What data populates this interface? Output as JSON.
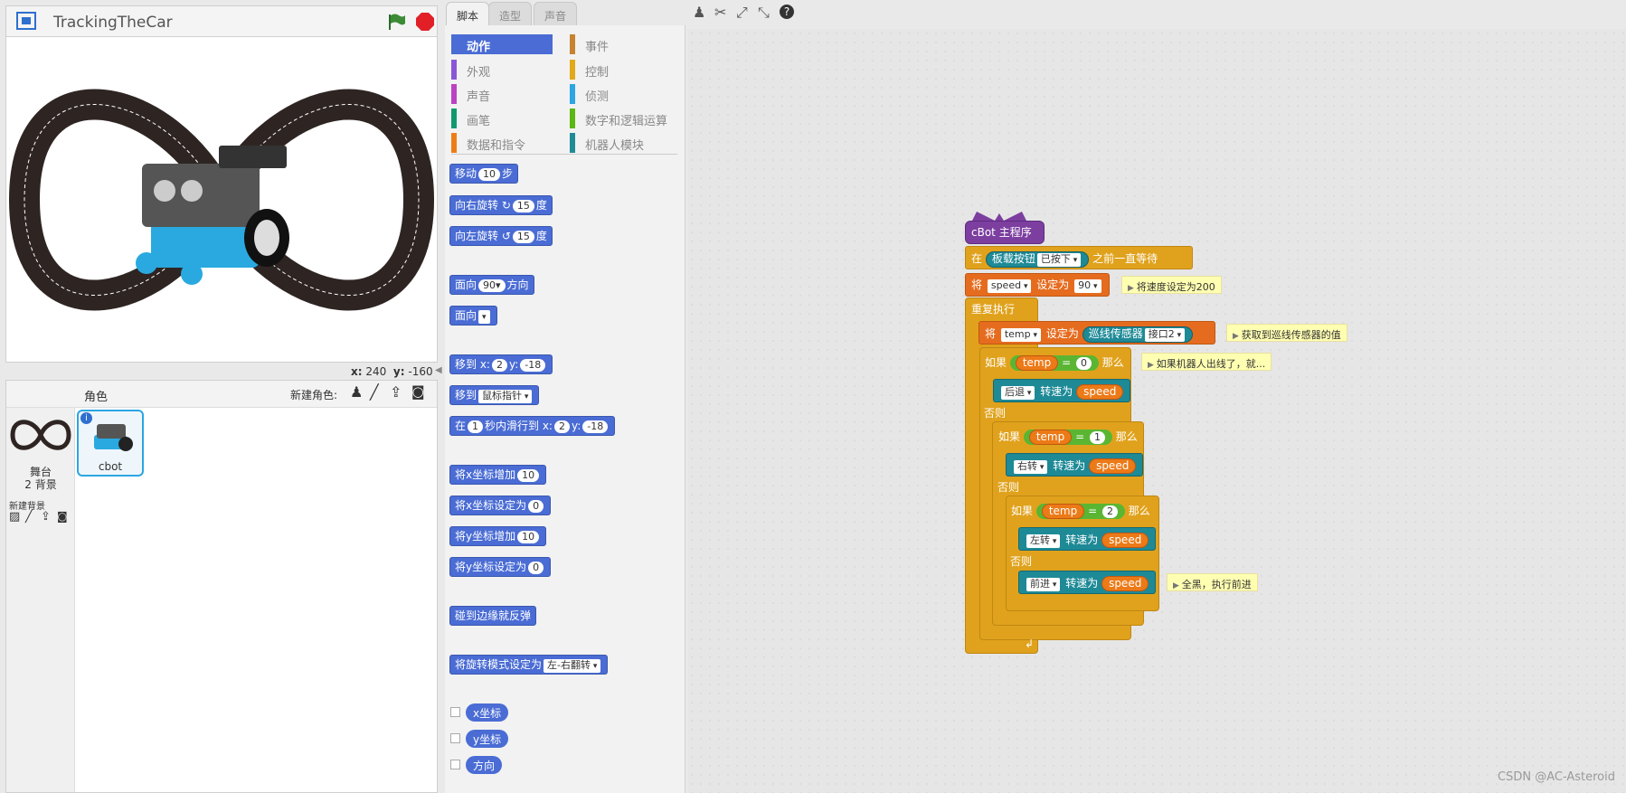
{
  "stage": {
    "title": "TrackingTheCar",
    "x_label": "x:",
    "x_value": "240",
    "y_label": "y:",
    "y_value": "-160"
  },
  "sprites": {
    "header": "角色",
    "new_sprite_label": "新建角色:",
    "stage_label": "舞台",
    "backdrop_count": "2 背景",
    "new_backdrop_label": "新建背景",
    "sprite_name": "cbot"
  },
  "tabs": [
    "脚本",
    "造型",
    "声音"
  ],
  "categories": {
    "left": [
      "动作",
      "外观",
      "声音",
      "画笔",
      "数据和指令"
    ],
    "right": [
      "事件",
      "控制",
      "侦测",
      "数字和逻辑运算",
      "机器人模块"
    ],
    "left_colors": [
      "#4a6cd4",
      "#8a55d7",
      "#bb42c3",
      "#0e9a6c",
      "#ee7d16"
    ],
    "right_colors": [
      "#c88330",
      "#e1a91a",
      "#2ca5e2",
      "#5cb712",
      "#1f8c95"
    ]
  },
  "palette": {
    "move": {
      "a": "移动",
      "n": "10",
      "b": "步"
    },
    "turn_right": {
      "a": "向右旋转",
      "n": "15",
      "b": "度"
    },
    "turn_left": {
      "a": "向左旋转",
      "n": "15",
      "b": "度"
    },
    "point_dir": {
      "a": "面向",
      "n": "90▾",
      "b": "方向"
    },
    "point_to": {
      "a": "面向"
    },
    "goto_xy": {
      "a": "移到 x:",
      "x": "2",
      "b": "y:",
      "y": "-18"
    },
    "goto": {
      "a": "移到",
      "d": "鼠标指针"
    },
    "glide": {
      "a": "在",
      "s": "1",
      "b": "秒内滑行到 x:",
      "x": "2",
      "c": "y:",
      "y": "-18"
    },
    "change_x": {
      "a": "将x坐标增加",
      "n": "10"
    },
    "set_x": {
      "a": "将x坐标设定为",
      "n": "0"
    },
    "change_y": {
      "a": "将y坐标增加",
      "n": "10"
    },
    "set_y": {
      "a": "将y坐标设定为",
      "n": "0"
    },
    "bounce": "碰到边缘就反弹",
    "rot_style": {
      "a": "将旋转模式设定为",
      "d": "左-右翻转"
    },
    "reporters": [
      "x坐标",
      "y坐标",
      "方向"
    ]
  },
  "script": {
    "hat": "cBot 主程序",
    "wait": {
      "a": "在",
      "sensor": "板载按钮",
      "opt": "已按下",
      "b": "之前一直等待"
    },
    "set_speed": {
      "a": "将",
      "var": "speed",
      "b": "设定为",
      "val": "90",
      "note": "将速度设定为200"
    },
    "forever": "重复执行",
    "set_temp": {
      "a": "将",
      "var": "temp",
      "b": "设定为",
      "sensor": "巡线传感器",
      "port": "接口2",
      "note": "获取到巡线传感器的值"
    },
    "if1": {
      "a": "如果",
      "var": "temp",
      "op": "=",
      "val": "0",
      "b": "那么",
      "note": "如果机器人出线了，就..."
    },
    "motor1": {
      "dir": "后退",
      "a": "转速为",
      "var": "speed"
    },
    "else": "否则",
    "if2": {
      "a": "如果",
      "var": "temp",
      "op": "=",
      "val": "1",
      "b": "那么"
    },
    "motor2": {
      "dir": "右转",
      "a": "转速为",
      "var": "speed"
    },
    "if3": {
      "a": "如果",
      "var": "temp",
      "op": "=",
      "val": "2",
      "b": "那么"
    },
    "motor3": {
      "dir": "左转",
      "a": "转速为",
      "var": "speed"
    },
    "motor4": {
      "dir": "前进",
      "a": "转速为",
      "var": "speed",
      "note": "全黑，执行前进"
    }
  },
  "watermark": "CSDN @AC-Asteroid"
}
